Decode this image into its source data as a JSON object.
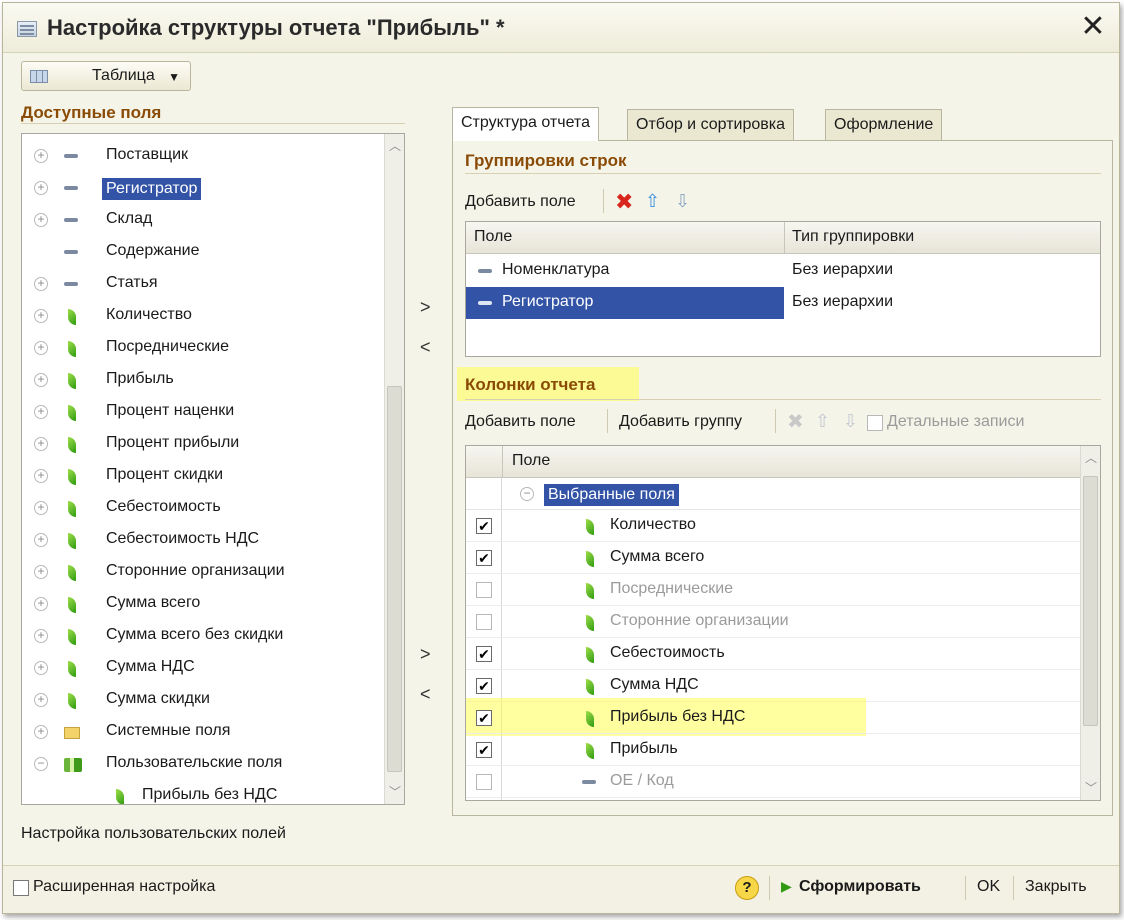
{
  "window": {
    "title": "Настройка структуры отчета \"Прибыль\" *",
    "close_symbol": "✕"
  },
  "view_selector": {
    "label": "Таблица"
  },
  "available_fields": {
    "title": "Доступные поля",
    "items": [
      {
        "label": "Поставщик",
        "icon": "dash-icon",
        "expand": true,
        "selected": false
      },
      {
        "label": "Регистратор",
        "icon": "dash-icon",
        "expand": true,
        "selected": true
      },
      {
        "label": "Склад",
        "icon": "dash-icon",
        "expand": true,
        "selected": false
      },
      {
        "label": "Содержание",
        "icon": "dash-icon",
        "expand": false,
        "selected": false
      },
      {
        "label": "Статья",
        "icon": "dash-icon",
        "expand": true,
        "selected": false
      },
      {
        "label": "Количество",
        "icon": "leaf-icon",
        "expand": true,
        "selected": false
      },
      {
        "label": "Посреднические",
        "icon": "leaf-icon",
        "expand": true,
        "selected": false
      },
      {
        "label": "Прибыль",
        "icon": "leaf-icon",
        "expand": true,
        "selected": false
      },
      {
        "label": "Процент наценки",
        "icon": "leaf-icon",
        "expand": true,
        "selected": false
      },
      {
        "label": "Процент прибыли",
        "icon": "leaf-icon",
        "expand": true,
        "selected": false
      },
      {
        "label": "Процент скидки",
        "icon": "leaf-icon",
        "expand": true,
        "selected": false
      },
      {
        "label": "Себестоимость",
        "icon": "leaf-icon",
        "expand": true,
        "selected": false
      },
      {
        "label": "Себестоимость НДС",
        "icon": "leaf-icon",
        "expand": true,
        "selected": false
      },
      {
        "label": "Сторонние организации",
        "icon": "leaf-icon",
        "expand": true,
        "selected": false
      },
      {
        "label": "Сумма всего",
        "icon": "leaf-icon",
        "expand": true,
        "selected": false
      },
      {
        "label": "Сумма всего без скидки",
        "icon": "leaf-icon",
        "expand": true,
        "selected": false
      },
      {
        "label": "Сумма НДС",
        "icon": "leaf-icon",
        "expand": true,
        "selected": false
      },
      {
        "label": "Сумма скидки",
        "icon": "leaf-icon",
        "expand": true,
        "selected": false
      },
      {
        "label": "Системные поля",
        "icon": "folder-icon",
        "expand": true,
        "selected": false
      },
      {
        "label": "Пользовательские поля",
        "icon": "user-fields-icon",
        "expand": "minus",
        "selected": false
      },
      {
        "label": "Прибыль без НДС",
        "icon": "leaf-icon",
        "expand": false,
        "selected": false,
        "child": true
      }
    ],
    "footer_text": "Настройка пользовательских полей"
  },
  "move_buttons": {
    "add": ">",
    "remove": "<"
  },
  "tabs": [
    {
      "label": "Структура отчета",
      "active": true
    },
    {
      "label": "Отбор и сортировка",
      "active": false
    },
    {
      "label": "Оформление",
      "active": false
    }
  ],
  "row_groupings": {
    "title": "Группировки строк",
    "add_field": "Добавить поле",
    "columns": [
      "Поле",
      "Тип группировки"
    ],
    "rows": [
      {
        "field": "Номенклатура",
        "type": "Без иерархии",
        "selected": false
      },
      {
        "field": "Регистратор",
        "type": "Без иерархии",
        "selected": true
      }
    ]
  },
  "report_columns": {
    "title": "Колонки отчета",
    "add_field": "Добавить поле",
    "add_group": "Добавить группу",
    "detail_records": "Детальные записи",
    "column_header": "Поле",
    "root": "Выбранные поля",
    "items": [
      {
        "label": "Количество",
        "checked": true,
        "icon": "leaf-icon"
      },
      {
        "label": "Сумма всего",
        "checked": true,
        "icon": "leaf-icon"
      },
      {
        "label": "Посреднические",
        "checked": false,
        "icon": "leaf-icon"
      },
      {
        "label": "Сторонние организации",
        "checked": false,
        "icon": "leaf-icon"
      },
      {
        "label": "Себестоимость",
        "checked": true,
        "icon": "leaf-icon"
      },
      {
        "label": "Сумма НДС",
        "checked": true,
        "icon": "leaf-icon"
      },
      {
        "label": "Прибыль без НДС",
        "checked": true,
        "icon": "leaf-icon",
        "highlight": true
      },
      {
        "label": "Прибыль",
        "checked": true,
        "icon": "leaf-icon"
      },
      {
        "label": "ОЕ / Код",
        "checked": false,
        "icon": "dash-icon"
      }
    ]
  },
  "bottom": {
    "advanced": "Расширенная настройка",
    "help": "?",
    "generate": "Сформировать",
    "ok": "OK",
    "close": "Закрыть"
  },
  "colors": {
    "accent_title": "#8a4b06",
    "selection": "#3253a6",
    "highlight": "#ffff50"
  }
}
